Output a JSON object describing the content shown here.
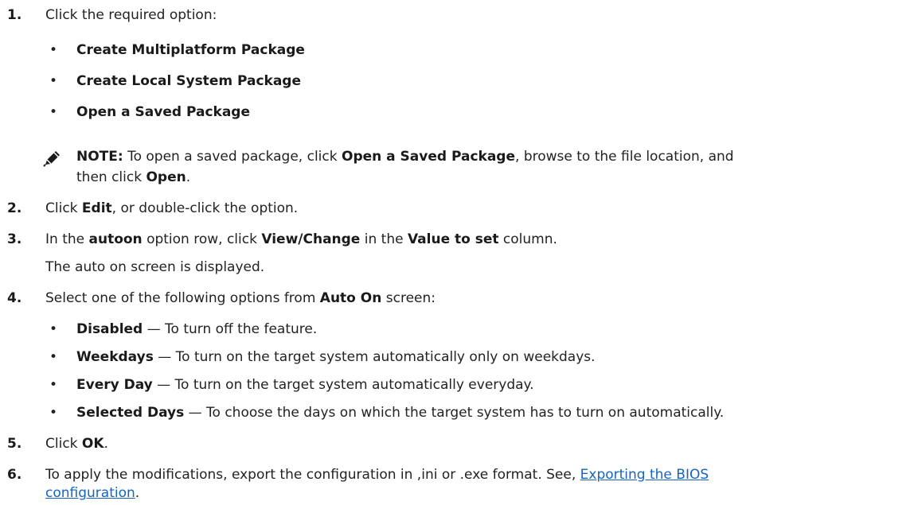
{
  "step1": {
    "num": "1.",
    "text": "Click the required option:",
    "bullets": [
      "Create Multiplatform Package",
      "Create Local System Package",
      "Open a Saved Package"
    ]
  },
  "note": {
    "icon": "pencil-note-icon",
    "label": "NOTE:",
    "t1": " To open a saved package, click ",
    "b1": "Open a Saved Package",
    "t2": ", browse to the file location, and",
    "t3": "then click ",
    "b2": "Open",
    "t4": "."
  },
  "step2": {
    "num": "2.",
    "t1": "Click ",
    "b1": "Edit",
    "t2": ", or double-click the option."
  },
  "step3": {
    "num": "3.",
    "t1": "In the ",
    "b1": "autoon",
    "t2": " option row, click ",
    "b2": "View/Change",
    "t3": " in the ",
    "b3": "Value to set",
    "t4": " column.",
    "sub": "The auto on screen is displayed."
  },
  "step4": {
    "num": "4.",
    "t1": "Select one of the following options from ",
    "b1": "Auto On",
    "t2": " screen:",
    "bullets": [
      {
        "term": "Disabled",
        "desc": " — To turn off the feature."
      },
      {
        "term": "Weekdays",
        "desc": " — To turn on the target system automatically only on weekdays."
      },
      {
        "term": "Every Day",
        "desc": " — To turn on the target system automatically everyday."
      },
      {
        "term": "Selected Days",
        "desc": " — To choose the days on which the target system has to turn on automatically."
      }
    ]
  },
  "step5": {
    "num": "5.",
    "t1": "Click ",
    "b1": "OK",
    "t2": "."
  },
  "step6": {
    "num": "6.",
    "t1": "To apply the modifications, export the configuration in ,ini or .exe format. See, ",
    "link1": "Exporting the BIOS",
    "link2": "configuration",
    "t2": "."
  },
  "colors": {
    "text": "#222222",
    "link": "#1565c0"
  }
}
